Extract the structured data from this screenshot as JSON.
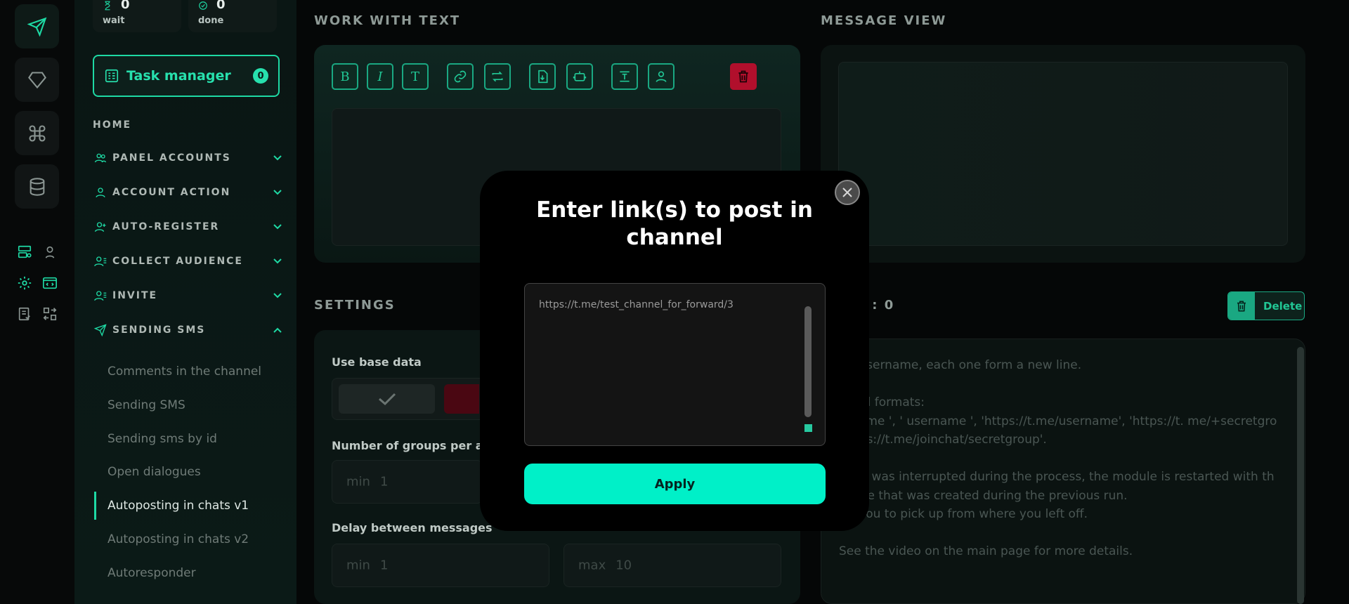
{
  "stats": [
    {
      "value": "0",
      "label": "wait"
    },
    {
      "value": "0",
      "label": "done"
    }
  ],
  "task_manager": {
    "label": "Task manager",
    "count": "0"
  },
  "nav": {
    "home": "HOME",
    "items": [
      {
        "label": "PANEL ACCOUNTS"
      },
      {
        "label": "ACCOUNT ACTION"
      },
      {
        "label": "AUTO-REGISTER"
      },
      {
        "label": "COLLECT AUDIENCE"
      },
      {
        "label": "INVITE"
      },
      {
        "label": "SENDING SMS"
      }
    ],
    "sub_items": [
      "Comments in the channel",
      "Sending SMS",
      "Sending sms by id",
      "Open dialogues",
      "Autoposting in chats v1",
      "Autoposting in chats v2",
      "Autoresponder"
    ],
    "active_sub": "Autoposting in chats v1"
  },
  "main": {
    "work_with_text_title": "WORK WITH TEXT",
    "message_view_title": "MESSAGE VIEW",
    "settings_title": "SETTINGS",
    "users_title": "S : 0",
    "delete_label": "Delete",
    "use_base_data_label": "Use base data",
    "groups_label": "Number of groups per accou",
    "groups_min_label": "min",
    "groups_min_value": "1",
    "delay_label": "Delay between messages",
    "delay_min_label": "min",
    "delay_min_value": "1",
    "delay_max_label": "max",
    "delay_max_value": "10",
    "help_text": "f @username, each one form a new line.\n\norted formats:\nername ', ' username ', 'https://t.me/username', 'https://t. me/+secretgro\n'https://t.me/joinchat/secretgroup'.\n\nwork was interrupted during the process, the module is restarted with th\nabase that was created during the previous run.\nws you to pick up from where you left off.\n\nSee the video on the main page for more details."
  },
  "toolbar": {
    "bold": "B",
    "italic": "I",
    "text": "T"
  },
  "modal": {
    "title": "Enter link(s) to post in channel",
    "textarea_value": "https://t.me/test_channel_for_forward/3",
    "apply_label": "Apply"
  },
  "colors": {
    "accent": "#1ed9a4",
    "apply": "#00f0c8",
    "danger": "#b10f2c"
  }
}
